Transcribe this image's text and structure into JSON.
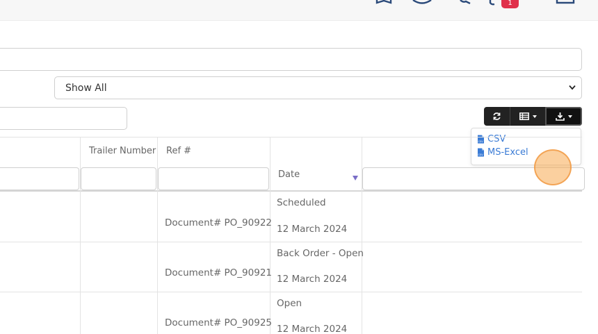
{
  "topbar": {
    "notification_count": "1",
    "icons": [
      "bookmark-icon",
      "help-icon",
      "search-icon",
      "notification-icon",
      "monitor-icon"
    ]
  },
  "filter": {
    "selected": "Show All"
  },
  "toolbar": {
    "buttons": [
      "refresh-icon",
      "columns-icon",
      "download-icon"
    ]
  },
  "export_menu": {
    "items": [
      {
        "label": "CSV",
        "icon": "csv-file-icon"
      },
      {
        "label": "MS-Excel",
        "icon": "csv-file-icon"
      }
    ]
  },
  "table": {
    "headers": {
      "trailer": "Trailer Number",
      "ref": "Ref #",
      "date": "Date"
    },
    "rows": [
      {
        "ref": "Document# PO_90922",
        "status": "Scheduled",
        "date": "12 March 2024"
      },
      {
        "ref": "Document# PO_90921",
        "status": "Back Order - Open",
        "date": "12 March 2024"
      },
      {
        "ref": "Document# PO_90925",
        "status": "Open",
        "date": "12 March 2024"
      }
    ]
  },
  "colors": {
    "link": "#3a7bd5",
    "badge": "#e0314b",
    "sort": "#7a6ec7",
    "button": "#222222"
  }
}
